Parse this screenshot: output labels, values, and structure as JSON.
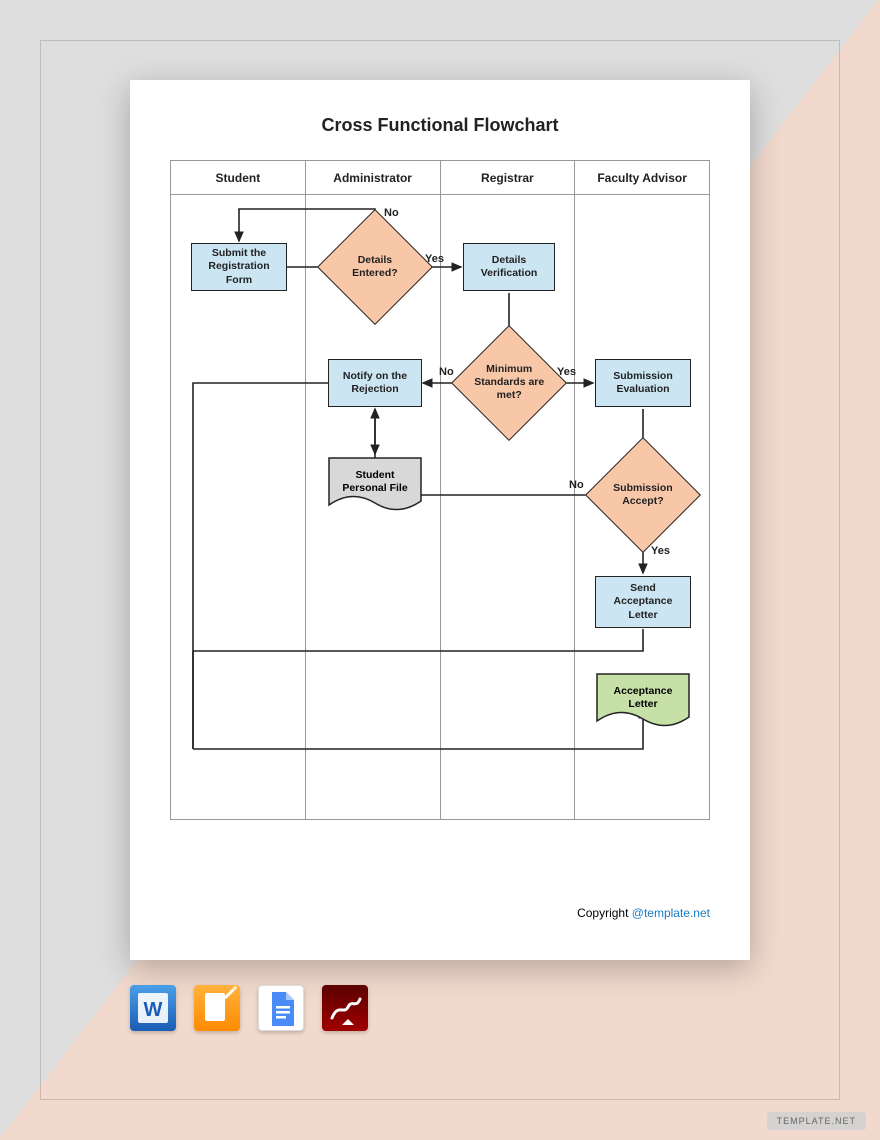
{
  "title": "Cross Functional Flowchart",
  "lanes": [
    "Student",
    "Administrator",
    "Registrar",
    "Faculty Advisor"
  ],
  "nodes": {
    "submit": "Submit the Registration Form",
    "details": "Details Entered?",
    "verify": "Details Verification",
    "notify": "Notify on the Rejection",
    "minstd": "Minimum Standards are met?",
    "subEval": "Submission Evaluation",
    "spf": "Student Personal File",
    "accept": "Submission Accept?",
    "send": "Send Acceptance Letter",
    "letter": "Acceptance Letter"
  },
  "edgeLabels": {
    "yes": "Yes",
    "no": "No"
  },
  "copyright": {
    "prefix": "Copyright ",
    "link": "@template.net"
  },
  "watermark": "TEMPLATE.NET",
  "formatIcons": [
    "Word",
    "Pages",
    "Google Docs",
    "PDF"
  ]
}
